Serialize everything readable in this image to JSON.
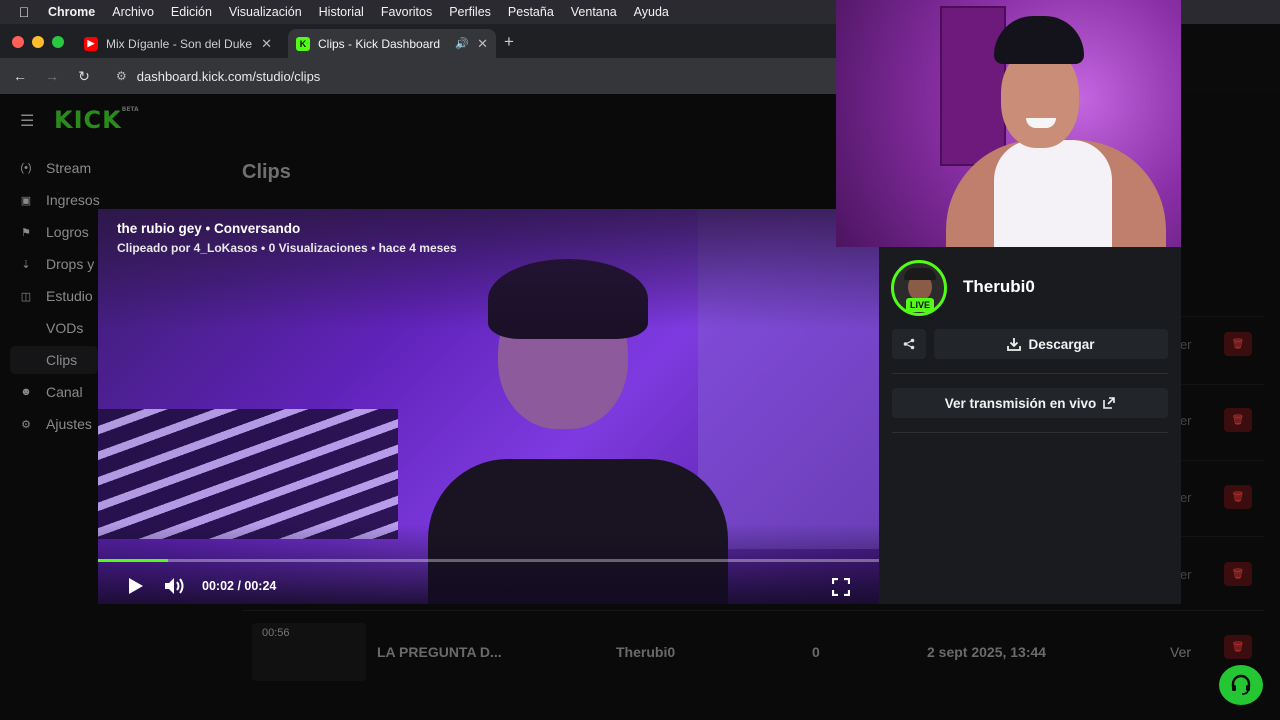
{
  "menubar": {
    "items": [
      "Chrome",
      "Archivo",
      "Edición",
      "Visualización",
      "Historial",
      "Favoritos",
      "Perfiles",
      "Pestaña",
      "Ventana",
      "Ayuda"
    ]
  },
  "tabs": [
    {
      "title": "Mix Díganle - Son del Duke -",
      "favicon": "youtube-icon"
    },
    {
      "title": "Clips - Kick Dashboard",
      "favicon": "kick-icon"
    }
  ],
  "address": {
    "url": "dashboard.kick.com/studio/clips"
  },
  "sidebar": {
    "logo": "KICK",
    "logo_badge": "BETA",
    "items": [
      {
        "label": "Stream",
        "icon": "broadcast-icon"
      },
      {
        "label": "Ingresos",
        "icon": "dollar-icon"
      },
      {
        "label": "Logros",
        "icon": "trophy-icon"
      },
      {
        "label": "Drops y",
        "icon": "drops-icon"
      },
      {
        "label": "Estudio",
        "icon": "studio-icon"
      },
      {
        "label": "VODs",
        "icon": ""
      },
      {
        "label": "Clips",
        "icon": ""
      },
      {
        "label": "Canal",
        "icon": "users-icon"
      },
      {
        "label": "Ajustes",
        "icon": "gear-icon"
      }
    ]
  },
  "main": {
    "title": "Clips",
    "row": {
      "duration": "00:56",
      "title": "LA PREGUNTA D...",
      "channel": "Therubi0",
      "views": "0",
      "date": "2 sept 2025, 13:44",
      "action": "Ver"
    },
    "ver_label": "Ver"
  },
  "player": {
    "title": "the rubio gey • Conversando",
    "subtitle": "Clipeado por 4_LoKasos • 0 Visualizaciones • hace 4 meses",
    "time": "00:02 / 00:24",
    "progress": 0.09,
    "accent": "#53fc18"
  },
  "panel": {
    "channel_name": "Therubi0",
    "live_badge": "LIVE",
    "download_label": "Descargar",
    "watch_live_label": "Ver transmisión en vivo"
  }
}
